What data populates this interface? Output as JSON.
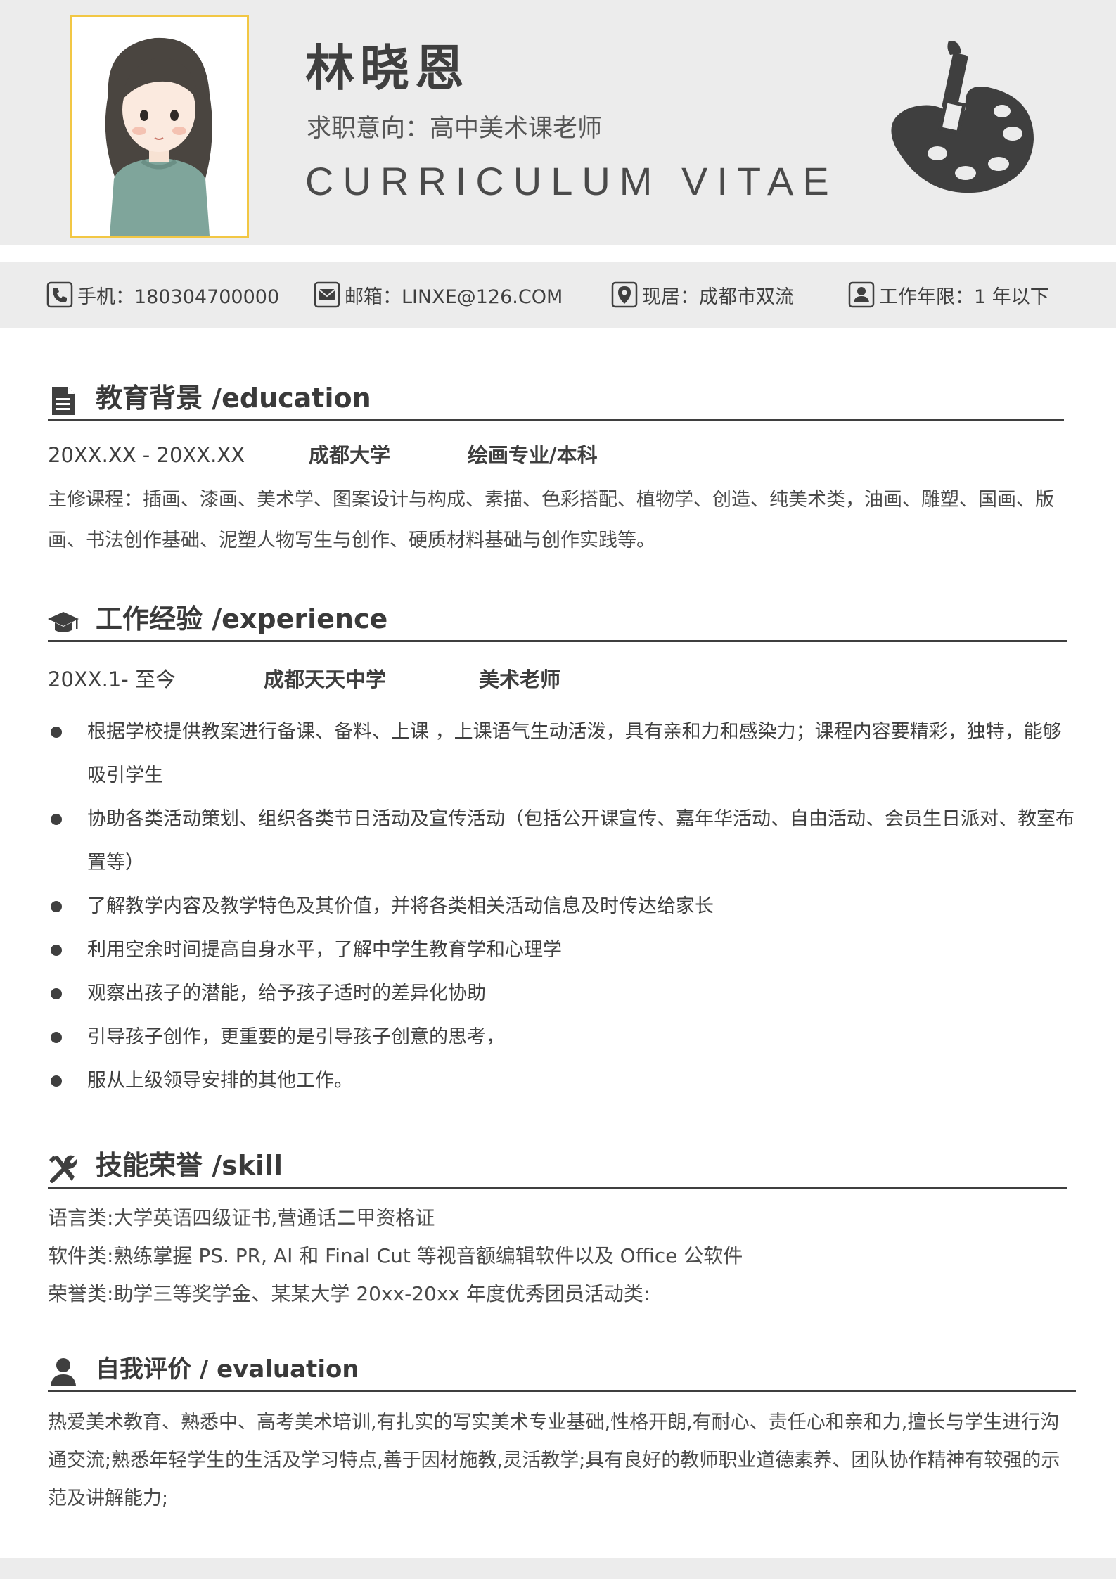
{
  "header": {
    "name": "林晓恩",
    "objective": "求职意向：高中美术课老师",
    "cv_title": "CURRICULUM VITAE",
    "photo_icon": "avatar-illustration",
    "logo_icon": "paint-palette-icon",
    "accent_color": "#f2c744",
    "background_color": "#ececec"
  },
  "contact": {
    "phone": "手机：180304700000",
    "email": "邮箱：LINXE@126.COM",
    "location": "现居：成都市双流",
    "work_years": "工作年限：1 年以下",
    "icons": [
      "phone-icon",
      "mail-icon",
      "location-icon",
      "user-icon"
    ]
  },
  "education": {
    "title": "教育背景 /education",
    "icon": "document-icon",
    "period": "20XX.XX - 20XX.XX",
    "school": "成都大学",
    "major": "绘画专业/本科",
    "courses": "主修课程：插画、漆画、美术学、图案设计与构成、素描、色彩搭配、植物学、创造、纯美术类，油画、雕塑、国画、版画、书法创作基础、泥塑人物写生与创作、硬质材料基础与创作实践等。"
  },
  "experience": {
    "title": "工作经验 /experience",
    "icon": "graduation-cap-icon",
    "period": "20XX.1- 至今",
    "company": "成都天天中学",
    "position": "美术老师",
    "items": [
      "根据学校提供教案进行备课、备料、上课 ，上课语气生动活泼，具有亲和力和感染力；课程内容要精彩，独特，能够吸引学生",
      "协助各类活动策划、组织各类节日活动及宣传活动（包括公开课宣传、嘉年华活动、自由活动、会员生日派对、教室布置等）",
      "了解教学内容及教学特色及其价值，并将各类相关活动信息及时传达给家长",
      "利用空余时间提高自身水平，了解中学生教育学和心理学",
      "观察出孩子的潜能，给予孩子适时的差异化协助",
      "引导孩子创作，更重要的是引导孩子创意的思考，",
      "服从上级领导安排的其他工作。"
    ]
  },
  "skill": {
    "title": "技能荣誉 /skill",
    "icon": "tools-icon",
    "lines": [
      "语言类:大学英语四级证书,营通话二甲资格证",
      "软件类:熟练掌握 PS. PR, AI 和 Final Cut 等视音额编辑软件以及 Office 公软件",
      "荣誉类:助学三等奖学金、某某大学 20xx-20xx 年度优秀团员活动类:"
    ]
  },
  "evaluation": {
    "title": "自我评价 / evaluation",
    "icon": "person-icon",
    "text": "热爱美术教育、熟悉中、高考美术培训,有扎实的写实美术专业基础,性格开朗,有耐心、责任心和亲和力,擅长与学生进行沟通交流;熟悉年轻学生的生活及学习特点,善于因材施教,灵活教学;具有良好的教师职业道德素养、团队协作精神有较强的示范及讲解能力;"
  }
}
